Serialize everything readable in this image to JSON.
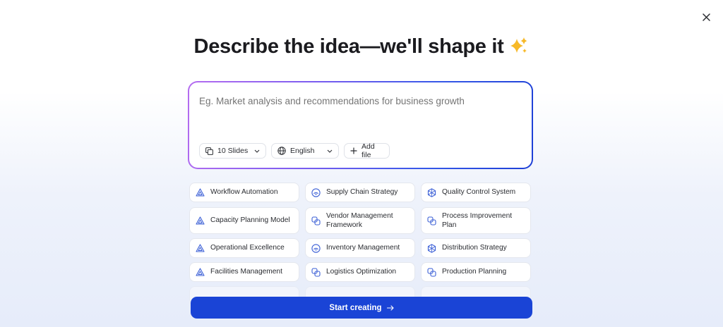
{
  "dialog": {
    "title": "Describe the idea—we'll shape it",
    "sparkle_icon": "sparkle-icon",
    "close_icon": "close-icon"
  },
  "prompt": {
    "placeholder": "Eg. Market analysis and recommendations for business growth",
    "value": ""
  },
  "controls": {
    "slides_label": "10 Slides",
    "language_label": "English",
    "add_file_label": "Add file"
  },
  "suggestions": [
    {
      "label": "Workflow Automation",
      "icon": "triangle-icon"
    },
    {
      "label": "Supply Chain Strategy",
      "icon": "signal-icon"
    },
    {
      "label": "Quality Control System",
      "icon": "hexagon-icon"
    },
    {
      "label": "Capacity Planning Model",
      "icon": "triangle-icon"
    },
    {
      "label": "Vendor Management Framework",
      "icon": "overlap-icon"
    },
    {
      "label": "Process Improvement Plan",
      "icon": "overlap-icon"
    },
    {
      "label": "Operational Excellence",
      "icon": "triangle-icon"
    },
    {
      "label": "Inventory Management",
      "icon": "signal-icon"
    },
    {
      "label": "Distribution Strategy",
      "icon": "hexagon-icon"
    },
    {
      "label": "Facilities Management",
      "icon": "triangle-icon"
    },
    {
      "label": "Logistics Optimization",
      "icon": "overlap-icon"
    },
    {
      "label": "Production Planning",
      "icon": "overlap-icon"
    }
  ],
  "cta": {
    "label": "Start creating"
  },
  "colors": {
    "accent": "#1a44d6",
    "icon": "#3b5fd6"
  }
}
